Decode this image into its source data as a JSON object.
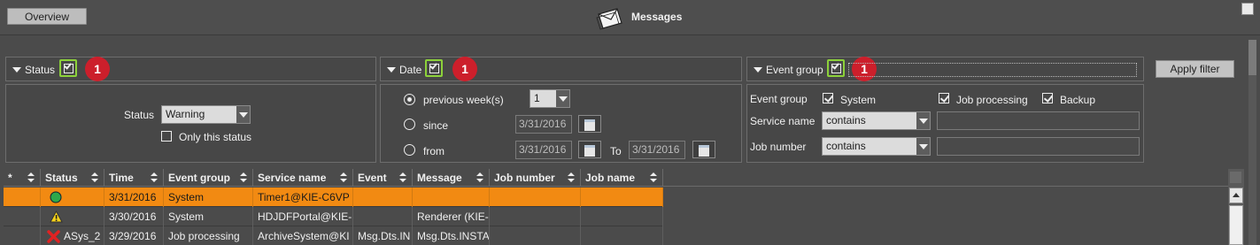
{
  "header": {
    "overview_label": "Overview",
    "title": "Messages"
  },
  "status_panel": {
    "label": "Status",
    "checked": true,
    "badge": "1",
    "status_label": "Status",
    "status_value": "Warning",
    "only_this_status": "Only this status"
  },
  "date_panel": {
    "label": "Date",
    "checked": true,
    "badge": "1",
    "previous_weeks_label": "previous week(s)",
    "previous_weeks_value": "1",
    "since_label": "since",
    "since_value": "3/31/2016",
    "from_label": "from",
    "from_value": "3/31/2016",
    "to_label": "To",
    "to_value": "3/31/2016"
  },
  "event_panel": {
    "label": "Event group",
    "checked": true,
    "badge": "1",
    "event_group_label": "Event group",
    "groups": [
      {
        "label": "System",
        "checked": true
      },
      {
        "label": "Job processing",
        "checked": true
      },
      {
        "label": "Backup",
        "checked": true
      }
    ],
    "service_name_label": "Service name",
    "service_name_op": "contains",
    "job_number_label": "Job number",
    "job_number_op": "contains"
  },
  "apply_filter_label": "Apply filter",
  "table": {
    "columns": [
      "*",
      "Status",
      "Time",
      "Event group",
      "Service name",
      "Event",
      "Message",
      "Job number",
      "Job name"
    ],
    "rows": [
      {
        "status": "ok",
        "status_text": "",
        "time": "3/31/2016",
        "event_group": "System",
        "service_name": "Timer1@KIE-C6VP",
        "event": "",
        "message": "",
        "job_number": "",
        "job_name": ""
      },
      {
        "status": "warning",
        "status_text": "",
        "time": "3/30/2016",
        "event_group": "System",
        "service_name": "HDJDFPortal@KIE-",
        "event": "",
        "message": "Renderer (KIE-",
        "job_number": "",
        "job_name": ""
      },
      {
        "status": "error",
        "status_text": "ASys_2",
        "time": "3/29/2016",
        "event_group": "Job processing",
        "service_name": "ArchiveSystem@KI",
        "event": "Msg.Dts.IN",
        "message": "Msg.Dts.INSTA",
        "job_number": "",
        "job_name": ""
      }
    ]
  },
  "colors": {
    "background": "#4b4b4b",
    "selected_row": "#f28a12",
    "highlight_border": "#8cd13a",
    "badge": "#cc1f2b",
    "status_ok": "#2fa84a",
    "status_warning": "#f5d21a",
    "status_error": "#e02222"
  }
}
